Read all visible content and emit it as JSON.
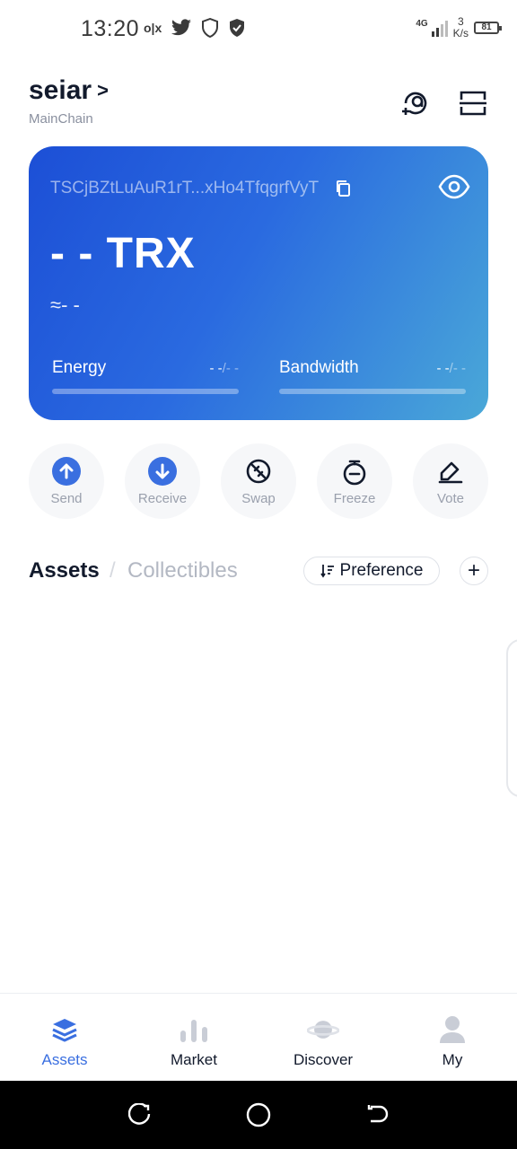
{
  "status_bar": {
    "time": "13:20",
    "network_type": "4G",
    "net_speed_value": "3",
    "net_speed_unit": "K/s",
    "battery": "81"
  },
  "header": {
    "wallet_name": "seiar",
    "chevron": ">",
    "chain": "MainChain"
  },
  "card": {
    "address": "TSCjBZtLuAuR1rT...xHo4TfqgrfVyT",
    "balance": "- - TRX",
    "fiat": "≈- -",
    "energy": {
      "label": "Energy",
      "value_main": "- -",
      "value_dim": "/- -",
      "progress": 0
    },
    "bandwidth": {
      "label": "Bandwidth",
      "value_main": "- -",
      "value_dim": "/- -",
      "progress": 0
    },
    "gradient_start": "#1c4fd6",
    "gradient_end": "#4aa8d8"
  },
  "actions": [
    {
      "label": "Send",
      "icon": "arrow-up-icon"
    },
    {
      "label": "Receive",
      "icon": "arrow-down-icon"
    },
    {
      "label": "Swap",
      "icon": "swap-icon"
    },
    {
      "label": "Freeze",
      "icon": "freeze-icon"
    },
    {
      "label": "Vote",
      "icon": "vote-icon"
    }
  ],
  "tabs": {
    "assets": "Assets",
    "separator": "/",
    "collectibles": "Collectibles",
    "preference": "Preference",
    "add": "+"
  },
  "bottom_nav": [
    {
      "label": "Assets",
      "icon": "layers-icon",
      "active": true
    },
    {
      "label": "Market",
      "icon": "bar-chart-icon",
      "active": false
    },
    {
      "label": "Discover",
      "icon": "planet-icon",
      "active": false
    },
    {
      "label": "My",
      "icon": "person-icon",
      "active": false
    }
  ],
  "colors": {
    "accent": "#3a6fe0",
    "text_primary": "#121a2c",
    "text_muted": "#9aa0ad"
  }
}
